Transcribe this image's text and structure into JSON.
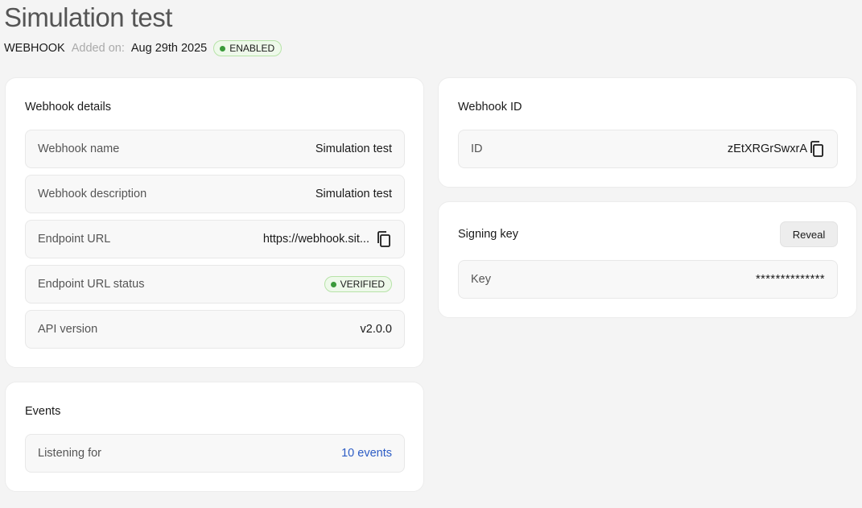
{
  "header": {
    "title": "Simulation test",
    "type": "WEBHOOK",
    "added_label": "Added on:",
    "added_date": "Aug 29th 2025",
    "status": "ENABLED"
  },
  "details": {
    "title": "Webhook details",
    "rows": [
      {
        "label": "Webhook name",
        "value": "Simulation test"
      },
      {
        "label": "Webhook description",
        "value": "Simulation test"
      },
      {
        "label": "Endpoint URL",
        "value": "https://webhook.sit..."
      },
      {
        "label": "Endpoint URL status",
        "value": "VERIFIED"
      },
      {
        "label": "API version",
        "value": "v2.0.0"
      }
    ]
  },
  "events": {
    "title": "Events",
    "label": "Listening for",
    "value": "10 events"
  },
  "webhook_id": {
    "title": "Webhook ID",
    "label": "ID",
    "value": "zEtXRGrSwxrA"
  },
  "signing_key": {
    "title": "Signing key",
    "reveal_label": "Reveal",
    "label": "Key",
    "value": "**************"
  },
  "colors": {
    "status_green": "#3a9a3a",
    "link_blue": "#2c5cc5"
  }
}
